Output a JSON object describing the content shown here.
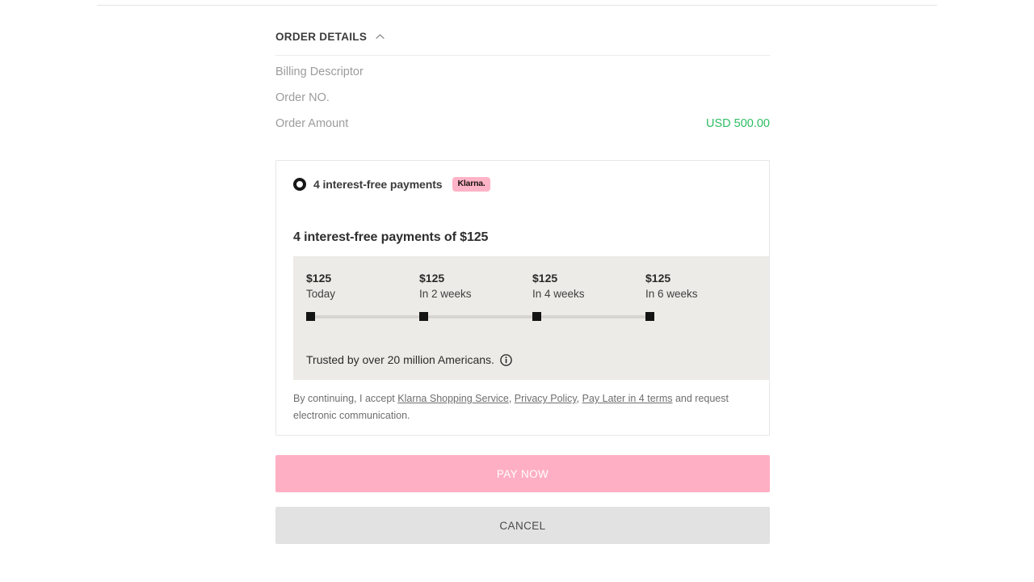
{
  "order_section": {
    "title": "ORDER DETAILS",
    "collapse_icon": "chevron-up-icon",
    "rows": [
      {
        "label": "Billing Descriptor",
        "value": ""
      },
      {
        "label": "Order NO.",
        "value": ""
      },
      {
        "label": "Order Amount",
        "value": "USD 500.00"
      }
    ],
    "amount_color": "#2DBD62"
  },
  "payment_option": {
    "selected": true,
    "label": "4 interest-free payments",
    "provider_badge": "Klarna.",
    "badge_bg": "#FFB3C7",
    "badge_text_color": "#17120F"
  },
  "plan": {
    "heading": "4 interest-free payments of $125",
    "panel_bg": "#EDEBE8",
    "installments": [
      {
        "amount": "$125",
        "when": "Today"
      },
      {
        "amount": "$125",
        "when": "In 2 weeks"
      },
      {
        "amount": "$125",
        "when": "In 4 weeks"
      },
      {
        "amount": "$125",
        "when": "In 6 weeks"
      }
    ],
    "trust_text": "Trusted by over 20 million Americans.",
    "info_icon": "info-circle-icon"
  },
  "legal": {
    "prefix": "By continuing, I accept ",
    "link_1": "Klarna Shopping Service",
    "sep_1": ", ",
    "link_2": "Privacy Policy",
    "sep_2": ", ",
    "link_3": "Pay Later in 4 terms",
    "suffix": " and request electronic communication."
  },
  "actions": {
    "pay_label": "PAY NOW",
    "pay_bg": "#FFAFC3",
    "cancel_label": "CANCEL",
    "cancel_bg": "#E2E2E2"
  }
}
